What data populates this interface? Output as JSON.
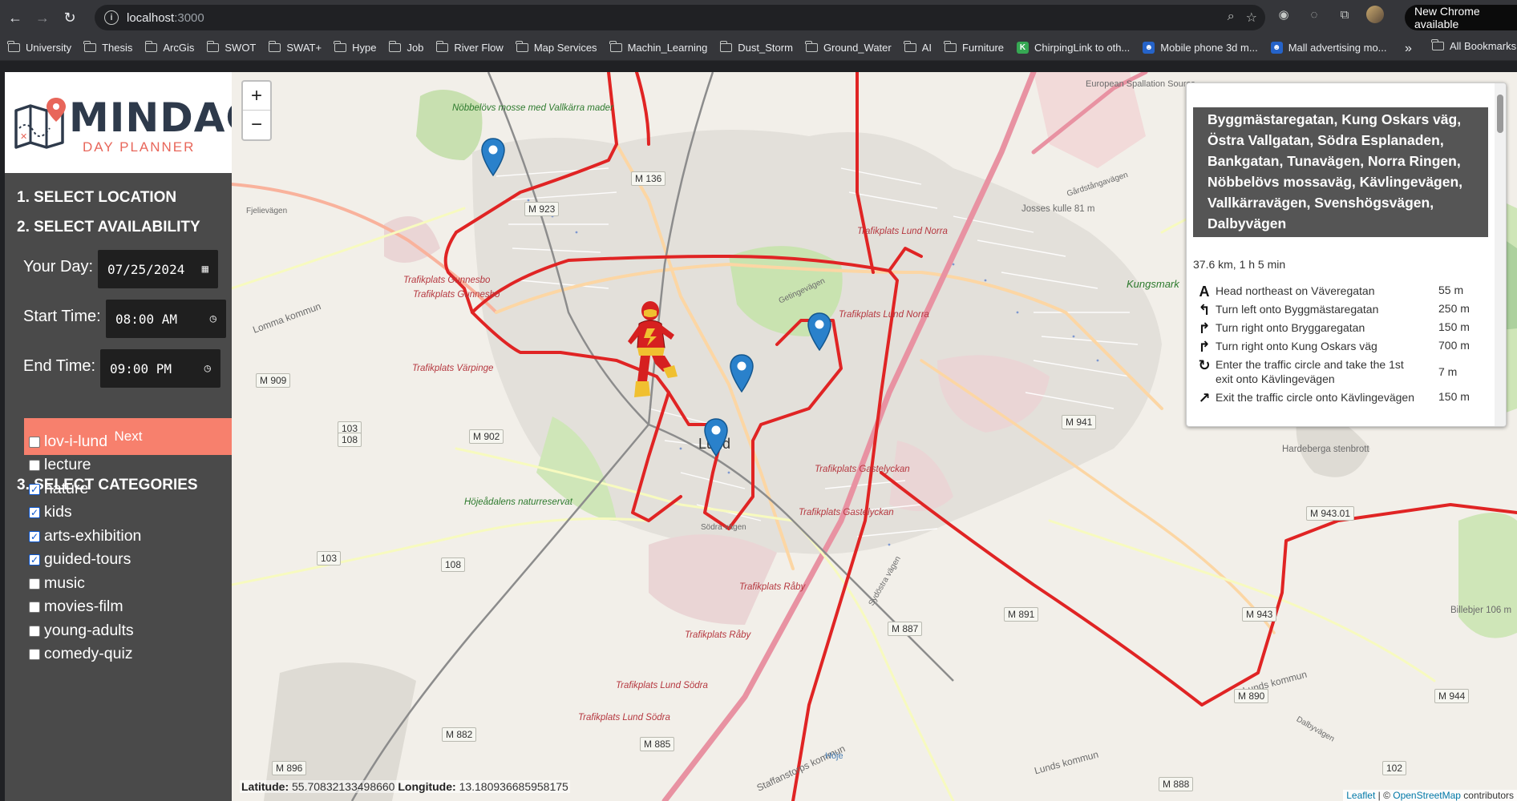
{
  "browser": {
    "url_host": "localhost",
    "url_port": ":3000",
    "new_chrome_label": "New Chrome available",
    "bookmarks": [
      "University",
      "Thesis",
      "ArcGis",
      "SWOT",
      "SWAT+",
      "Hype",
      "Job",
      "River Flow",
      "Map Services",
      "Machin_Learning",
      "Dust_Storm",
      "Ground_Water",
      "AI",
      "Furniture"
    ],
    "bookmark_links": [
      "ChirpingLink to oth...",
      "Mobile phone 3d m...",
      "Mall advertising mo..."
    ],
    "more_label": "»",
    "all_bookmarks_label": "All Bookmarks"
  },
  "logo": {
    "title": "MINDAG",
    "subtitle": "DAY PLANNER"
  },
  "steps": {
    "select_location": "1. SELECT LOCATION",
    "select_availability": "2. SELECT AVAILABILITY",
    "select_categories": "3. SELECT CATEGORIES"
  },
  "availability": {
    "day_label": "Your Day:",
    "day_value": "07/25/2024",
    "start_label": "Start Time:",
    "start_value": "08:00 AM",
    "end_label": "End Time:",
    "end_value": "09:00 PM"
  },
  "next_label": "Next",
  "categories": [
    {
      "label": "lov-i-lund",
      "checked": false
    },
    {
      "label": "lecture",
      "checked": false
    },
    {
      "label": "nature",
      "checked": true
    },
    {
      "label": "kids",
      "checked": true
    },
    {
      "label": "arts-exhibition",
      "checked": true
    },
    {
      "label": "guided-tours",
      "checked": true
    },
    {
      "label": "music",
      "checked": false
    },
    {
      "label": "movies-film",
      "checked": false
    },
    {
      "label": "young-adults",
      "checked": false
    },
    {
      "label": "comedy-quiz",
      "checked": false
    }
  ],
  "map": {
    "zoom_in": "+",
    "zoom_out": "−",
    "city_label": "Lund",
    "labels": {
      "european_spallation": "European Spallation Source",
      "nobbelovs_mosse": "Nöbbelövs mosse med Vallkärra mader",
      "trafikplats_gunnesbo": "Trafikplats Gunnesbo",
      "trafikplats_varpinge": "Trafikplats Värpinge",
      "trafikplats_lund_norra_1": "Trafikplats Lund Norra",
      "trafikplats_lund_norra_2": "Trafikplats Lund Norra",
      "trafikplats_gastelyckan_1": "Trafikplats Gastelyckan",
      "trafikplats_gastelyckan_2": "Trafikplats Gastelyckan",
      "trafikplats_raby_1": "Trafikplats Råby",
      "trafikplats_raby_2": "Trafikplats Råby",
      "trafikplats_lund_sodra_1": "Trafikplats Lund Södra",
      "trafikplats_lund_sodra_2": "Trafikplats Lund Södra",
      "fjelievagen": "Fjelievägen",
      "lomma_kommun": "Lomma kommun",
      "lunds_kommun_1": "Lunds kommun",
      "lunds_kommun_2": "Lunds kommun",
      "staffanstorps_kommun": "Staffanstorps kommun",
      "hojeadalens": "Höjeådalens naturreservat",
      "josses_kulle": "Josses kulle 81 m",
      "kungsmark": "Kungsmark",
      "hardeberga": "Hardeberga stenbrott",
      "billebjer": "Billebjer 106 m",
      "gardstangavagen": "Gårdstångavägen",
      "sodra_vagen": "Södra vägen",
      "dalbyvagen": "Dalbyvägen",
      "getingevagen": "Getingevägen",
      "sydostra_vagen": "Sydöstra vägen",
      "hoje": "Höje"
    },
    "shields": [
      "M 136",
      "M 923",
      "M 909",
      "M 902",
      "M 941",
      "M 943.01",
      "M 891",
      "M 887",
      "M 890",
      "M 944",
      "M 882",
      "M 885",
      "M 896",
      "M 888",
      "M 943",
      "103",
      "108",
      "103",
      "108",
      "102"
    ],
    "coords": {
      "lat_label": "Latitude:",
      "lat_value": "55.70832133498660",
      "lng_label": "Longitude:",
      "lng_value": "13.180936685958175"
    },
    "attribution": {
      "leaflet": "Leaflet",
      "sep": " | © ",
      "osm": "OpenStreetMap",
      "rest": " contributors"
    }
  },
  "route": {
    "name": "Byggmästaregatan, Kung Oskars väg, Östra Vallgatan, Södra Esplanaden, Bankgatan, Tunavägen, Norra Ringen, Nöbbelövs mossaväg, Kävlingevägen, Vallkärravägen, Svenshögsvägen, Dalbyvägen",
    "summary": "37.6 km, 1 h 5 min",
    "instructions": [
      {
        "icon": "depart-icon",
        "glyph": "A",
        "text": "Head northeast on Väveregatan",
        "distance": "55 m"
      },
      {
        "icon": "turn-left-icon",
        "glyph": "↰",
        "text": "Turn left onto Byggmästaregatan",
        "distance": "250 m"
      },
      {
        "icon": "turn-right-icon",
        "glyph": "↱",
        "text": "Turn right onto Bryggaregatan",
        "distance": "150 m"
      },
      {
        "icon": "turn-right-icon",
        "glyph": "↱",
        "text": "Turn right onto Kung Oskars väg",
        "distance": "700 m"
      },
      {
        "icon": "roundabout-icon",
        "glyph": "↻",
        "text": "Enter the traffic circle and take the 1st exit onto Kävlingevägen",
        "distance": "7 m"
      },
      {
        "icon": "bear-right-icon",
        "glyph": "↗",
        "text": "Exit the traffic circle onto Kävlingevägen",
        "distance": "150 m"
      }
    ]
  },
  "colors": {
    "route": "#e02424",
    "accent": "#f7806d",
    "sidebar": "#4a4a4a",
    "marker": "#2a81cb"
  }
}
